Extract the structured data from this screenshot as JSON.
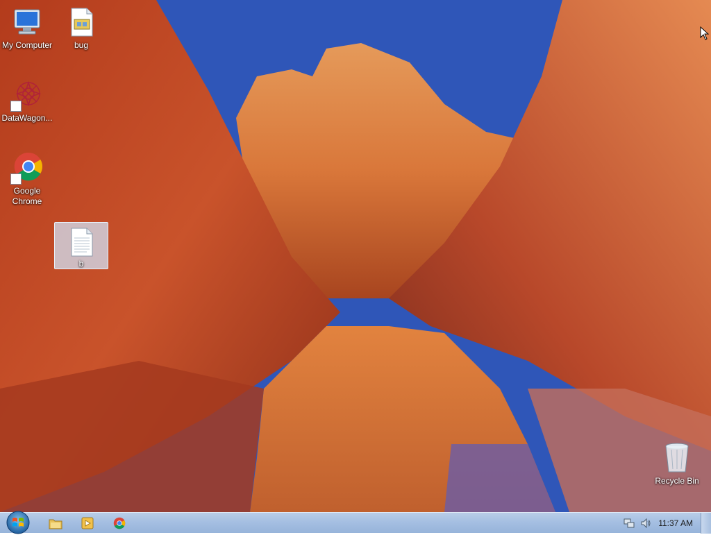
{
  "desktop": {
    "icons": [
      {
        "label": "My Computer"
      },
      {
        "label": "bug"
      },
      {
        "label": "DataWagon..."
      },
      {
        "label": "Google Chrome"
      },
      {
        "label": "b"
      },
      {
        "label": "Recycle Bin"
      }
    ]
  },
  "taskbar": {
    "start_icon": "windows-logo-icon",
    "pinned": [
      {
        "icon": "windows-explorer-icon"
      },
      {
        "icon": "media-player-icon"
      },
      {
        "icon": "chrome-icon"
      }
    ],
    "tray": {
      "icons": [
        "network-icon",
        "speaker-icon"
      ],
      "time": "11:37 AM"
    }
  },
  "colors": {
    "taskbar": "#a5bfe2",
    "selection": "#d2e1f5"
  }
}
